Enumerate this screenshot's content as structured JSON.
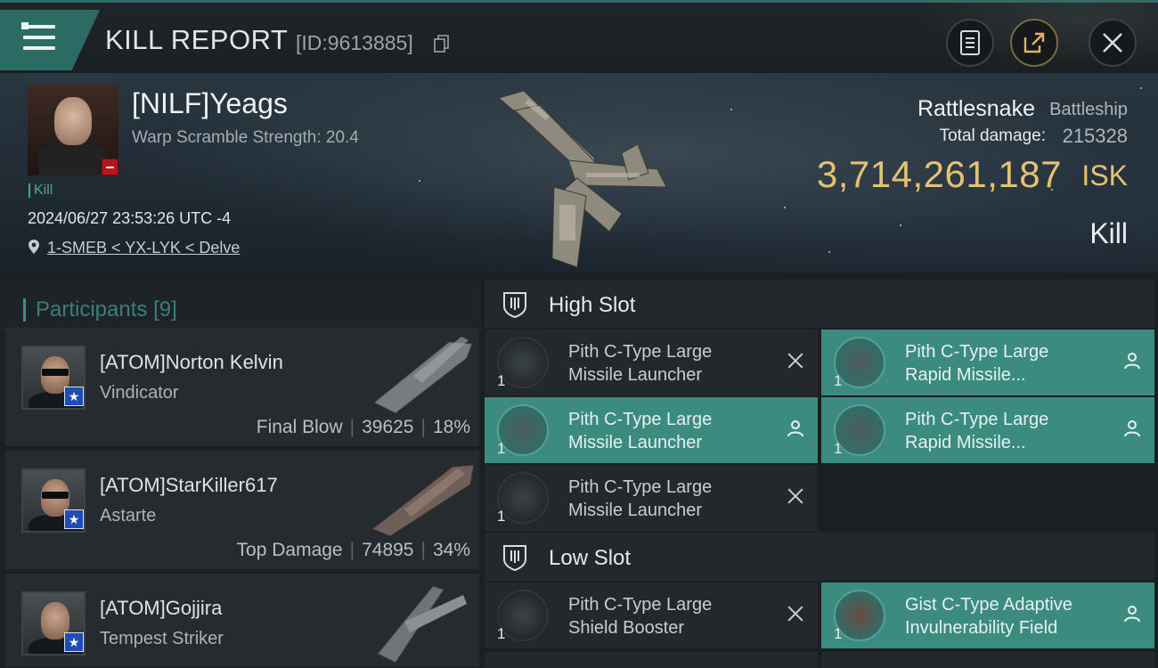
{
  "topbar": {
    "title": "KILL REPORT",
    "report_id": "[ID:9613885]",
    "icons": [
      "menu-icon",
      "copy-icon",
      "report-icon",
      "share-icon",
      "close-icon"
    ]
  },
  "victim": {
    "pilot_name": "[NILF]Yeags",
    "warp_scramble": "Warp Scramble Strength: 20.4",
    "kill_tag": "Kill",
    "datetime": "2024/06/27 23:53:26 UTC -4",
    "location": "1-SMEB < YX-LYK < Delve",
    "ship_name": "Rattlesnake",
    "ship_class": "Battleship",
    "total_damage_label": "Total damage:",
    "total_damage": "215328",
    "isk_value": "3,714,261,187",
    "isk_unit": "ISK",
    "status": "Kill"
  },
  "participants": {
    "label": "Participants",
    "count": "[9]",
    "rows": [
      {
        "name": "[ATOM]Norton Kelvin",
        "ship": "Vindicator",
        "tag": "Final Blow",
        "damage": "39625",
        "percent": "18%"
      },
      {
        "name": "[ATOM]StarKiller617",
        "ship": "Astarte",
        "tag": "Top Damage",
        "damage": "74895",
        "percent": "34%"
      },
      {
        "name": "[ATOM]Gojjira",
        "ship": "Tempest Striker"
      }
    ]
  },
  "fitting": {
    "high_slot": {
      "label": "High Slot",
      "modules": [
        {
          "line1": "Pith C-Type Large",
          "line2": "Missile Launcher",
          "qty": "1",
          "state": "destroyed"
        },
        {
          "line1": "Pith C-Type Large",
          "line2": "Rapid Missile...",
          "qty": "1",
          "state": "dropped"
        },
        {
          "line1": "Pith C-Type Large",
          "line2": "Missile Launcher",
          "qty": "1",
          "state": "dropped"
        },
        {
          "line1": "Pith C-Type Large",
          "line2": "Rapid Missile...",
          "qty": "1",
          "state": "dropped"
        },
        {
          "line1": "Pith C-Type Large",
          "line2": "Missile Launcher",
          "qty": "1",
          "state": "destroyed"
        }
      ]
    },
    "low_slot": {
      "label": "Low Slot",
      "modules": [
        {
          "line1": "Pith C-Type Large",
          "line2": "Shield Booster",
          "qty": "1",
          "state": "destroyed"
        },
        {
          "line1": "Gist C-Type Adaptive",
          "line2": "Invulnerability Field",
          "qty": "1",
          "state": "dropped"
        }
      ]
    }
  },
  "colors": {
    "accent": "#3c8b81",
    "isk": "#e3c271",
    "badge_red": "#b3161b",
    "badge_blue": "#1e4fb0"
  }
}
